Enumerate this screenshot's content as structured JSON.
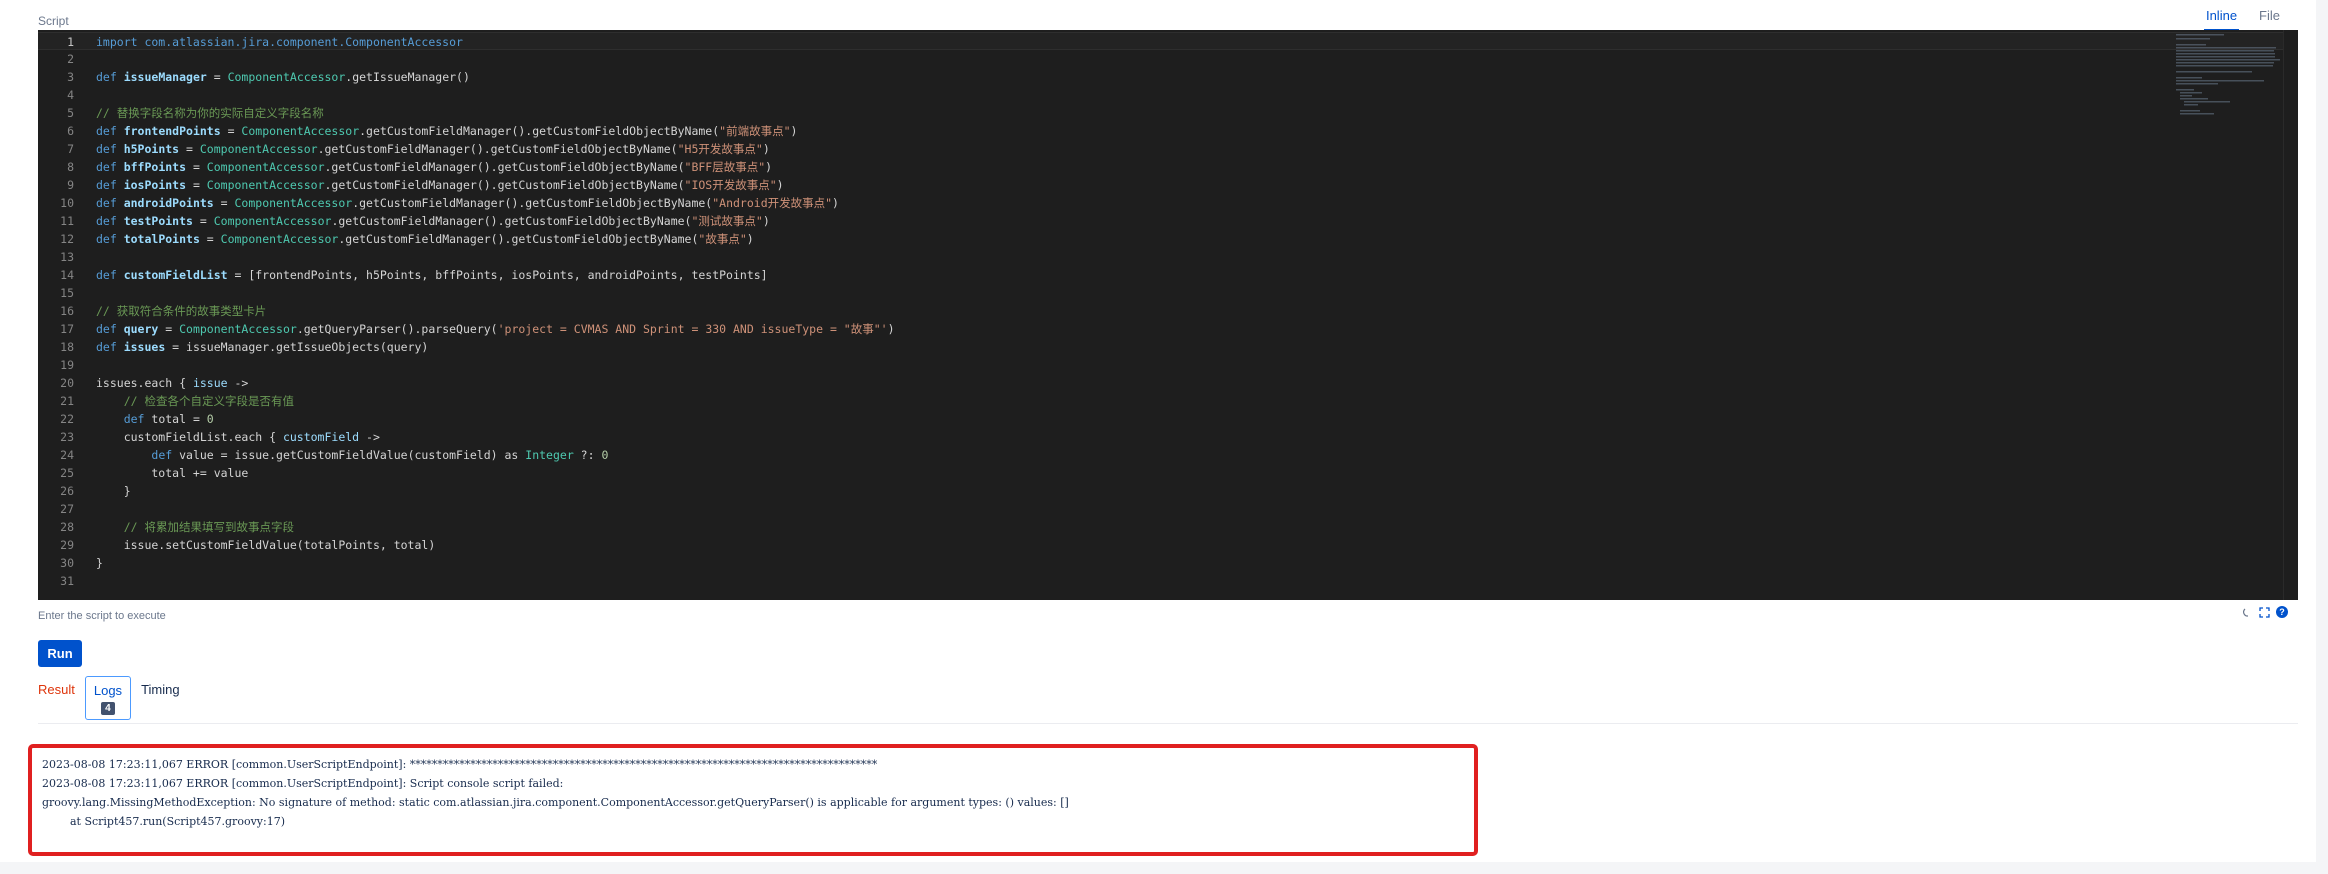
{
  "header": {
    "script_label": "Script",
    "tabs": [
      "Inline",
      "File"
    ],
    "active_tab": "Inline"
  },
  "editor": {
    "lines": [
      [
        {
          "t": "kw",
          "v": "import com.atlassian.jira.component.ComponentAccessor"
        }
      ],
      [],
      [
        {
          "t": "kw",
          "v": "def "
        },
        {
          "t": "bold",
          "v": "issueManager"
        },
        {
          "t": "txt",
          "v": " = "
        },
        {
          "t": "cls",
          "v": "ComponentAccessor"
        },
        {
          "t": "txt",
          "v": ".getIssueManager()"
        }
      ],
      [],
      [
        {
          "t": "com",
          "v": "// 替换字段名称为你的实际自定义字段名称"
        }
      ],
      [
        {
          "t": "kw",
          "v": "def "
        },
        {
          "t": "bold",
          "v": "frontendPoints"
        },
        {
          "t": "txt",
          "v": " = "
        },
        {
          "t": "cls",
          "v": "ComponentAccessor"
        },
        {
          "t": "txt",
          "v": ".getCustomFieldManager().getCustomFieldObjectByName("
        },
        {
          "t": "str",
          "v": "\"前端故事点\""
        },
        {
          "t": "txt",
          "v": ")"
        }
      ],
      [
        {
          "t": "kw",
          "v": "def "
        },
        {
          "t": "bold",
          "v": "h5Points"
        },
        {
          "t": "txt",
          "v": " = "
        },
        {
          "t": "cls",
          "v": "ComponentAccessor"
        },
        {
          "t": "txt",
          "v": ".getCustomFieldManager().getCustomFieldObjectByName("
        },
        {
          "t": "str",
          "v": "\"H5开发故事点\""
        },
        {
          "t": "txt",
          "v": ")"
        }
      ],
      [
        {
          "t": "kw",
          "v": "def "
        },
        {
          "t": "bold",
          "v": "bffPoints"
        },
        {
          "t": "txt",
          "v": " = "
        },
        {
          "t": "cls",
          "v": "ComponentAccessor"
        },
        {
          "t": "txt",
          "v": ".getCustomFieldManager().getCustomFieldObjectByName("
        },
        {
          "t": "str",
          "v": "\"BFF层故事点\""
        },
        {
          "t": "txt",
          "v": ")"
        }
      ],
      [
        {
          "t": "kw",
          "v": "def "
        },
        {
          "t": "bold",
          "v": "iosPoints"
        },
        {
          "t": "txt",
          "v": " = "
        },
        {
          "t": "cls",
          "v": "ComponentAccessor"
        },
        {
          "t": "txt",
          "v": ".getCustomFieldManager().getCustomFieldObjectByName("
        },
        {
          "t": "str",
          "v": "\"IOS开发故事点\""
        },
        {
          "t": "txt",
          "v": ")"
        }
      ],
      [
        {
          "t": "kw",
          "v": "def "
        },
        {
          "t": "bold",
          "v": "androidPoints"
        },
        {
          "t": "txt",
          "v": " = "
        },
        {
          "t": "cls",
          "v": "ComponentAccessor"
        },
        {
          "t": "txt",
          "v": ".getCustomFieldManager().getCustomFieldObjectByName("
        },
        {
          "t": "str",
          "v": "\"Android开发故事点\""
        },
        {
          "t": "txt",
          "v": ")"
        }
      ],
      [
        {
          "t": "kw",
          "v": "def "
        },
        {
          "t": "bold",
          "v": "testPoints"
        },
        {
          "t": "txt",
          "v": " = "
        },
        {
          "t": "cls",
          "v": "ComponentAccessor"
        },
        {
          "t": "txt",
          "v": ".getCustomFieldManager().getCustomFieldObjectByName("
        },
        {
          "t": "str",
          "v": "\"测试故事点\""
        },
        {
          "t": "txt",
          "v": ")"
        }
      ],
      [
        {
          "t": "kw",
          "v": "def "
        },
        {
          "t": "bold",
          "v": "totalPoints"
        },
        {
          "t": "txt",
          "v": " = "
        },
        {
          "t": "cls",
          "v": "ComponentAccessor"
        },
        {
          "t": "txt",
          "v": ".getCustomFieldManager().getCustomFieldObjectByName("
        },
        {
          "t": "str",
          "v": "\"故事点\""
        },
        {
          "t": "txt",
          "v": ")"
        }
      ],
      [],
      [
        {
          "t": "kw",
          "v": "def "
        },
        {
          "t": "bold",
          "v": "customFieldList"
        },
        {
          "t": "txt",
          "v": " = [frontendPoints, h5Points, bffPoints, iosPoints, androidPoints, testPoints]"
        }
      ],
      [],
      [
        {
          "t": "com",
          "v": "// 获取符合条件的故事类型卡片"
        }
      ],
      [
        {
          "t": "kw",
          "v": "def "
        },
        {
          "t": "bold",
          "v": "query"
        },
        {
          "t": "txt",
          "v": " = "
        },
        {
          "t": "cls",
          "v": "ComponentAccessor"
        },
        {
          "t": "txt",
          "v": ".getQueryParser().parseQuery("
        },
        {
          "t": "str",
          "v": "'project = CVMAS AND Sprint = 330 AND issueType = \"故事\"'"
        },
        {
          "t": "txt",
          "v": ")"
        }
      ],
      [
        {
          "t": "kw",
          "v": "def "
        },
        {
          "t": "bold",
          "v": "issues"
        },
        {
          "t": "txt",
          "v": " = issueManager.getIssueObjects(query)"
        }
      ],
      [],
      [
        {
          "t": "txt",
          "v": "issues.each { "
        },
        {
          "t": "var",
          "v": "issue"
        },
        {
          "t": "txt",
          "v": " ->"
        }
      ],
      [
        {
          "t": "txt",
          "v": "    "
        },
        {
          "t": "com",
          "v": "// 检查各个自定义字段是否有值"
        }
      ],
      [
        {
          "t": "txt",
          "v": "    "
        },
        {
          "t": "kw",
          "v": "def "
        },
        {
          "t": "txt",
          "v": "total = "
        },
        {
          "t": "num",
          "v": "0"
        }
      ],
      [
        {
          "t": "txt",
          "v": "    customFieldList.each { "
        },
        {
          "t": "var",
          "v": "customField"
        },
        {
          "t": "txt",
          "v": " ->"
        }
      ],
      [
        {
          "t": "txt",
          "v": "        "
        },
        {
          "t": "kw",
          "v": "def "
        },
        {
          "t": "txt",
          "v": "value = issue.getCustomFieldValue(customField) as "
        },
        {
          "t": "cls",
          "v": "Integer"
        },
        {
          "t": "txt",
          "v": " ?: "
        },
        {
          "t": "num",
          "v": "0"
        }
      ],
      [
        {
          "t": "txt",
          "v": "        total += value"
        }
      ],
      [
        {
          "t": "txt",
          "v": "    }"
        }
      ],
      [],
      [
        {
          "t": "txt",
          "v": "    "
        },
        {
          "t": "com",
          "v": "// 将累加结果填写到故事点字段"
        }
      ],
      [
        {
          "t": "txt",
          "v": "    issue.setCustomFieldValue(totalPoints, total)"
        }
      ],
      [
        {
          "t": "txt",
          "v": "}"
        }
      ],
      []
    ],
    "hint": "Enter the script to execute"
  },
  "actions": {
    "run_label": "Run"
  },
  "result_tabs": {
    "result_label": "Result",
    "logs_label": "Logs",
    "logs_count": "4",
    "timing_label": "Timing"
  },
  "logs": [
    "2023-08-08 17:23:11,067 ERROR [common.UserScriptEndpoint]: *************************************************************************************",
    "2023-08-08 17:23:11,067 ERROR [common.UserScriptEndpoint]: Script console script failed:",
    "groovy.lang.MissingMethodException: No signature of method: static com.atlassian.jira.component.ComponentAccessor.getQueryParser() is applicable for argument types: () values: []",
    "        at Script457.run(Script457.groovy:17)"
  ],
  "colors": {
    "accent": "#0052cc",
    "error": "#de350b",
    "highlight_border": "#e02020",
    "editor_bg": "#1e1e1e"
  }
}
